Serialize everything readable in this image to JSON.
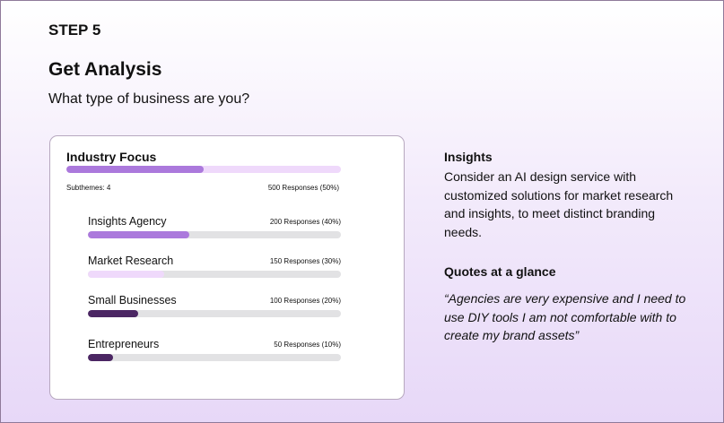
{
  "step_label": "STEP 5",
  "title": "Get Analysis",
  "question": "What type of business are you?",
  "card": {
    "title": "Industry Focus",
    "main_fraction": 0.5,
    "main_fill_color": "#ab79dc",
    "subthemes": "Subthemes: 4",
    "total": "500 Responses (50%)",
    "rows": [
      {
        "label": "Insights Agency",
        "responses": "200 Responses (40%)",
        "fraction": 0.4,
        "color": "#ab79dc"
      },
      {
        "label": "Market Research",
        "responses": "150 Responses (30%)",
        "fraction": 0.3,
        "color": "#efd9fb"
      },
      {
        "label": "Small Businesses",
        "responses": "100 Responses (20%)",
        "fraction": 0.2,
        "color": "#4b2663"
      },
      {
        "label": "Entrepreneurs",
        "responses": "50 Responses (10%)",
        "fraction": 0.1,
        "color": "#4b2663"
      }
    ]
  },
  "insights": {
    "heading": "Insights",
    "text": "Consider an AI design service with customized solutions for market research and insights,  to meet distinct branding needs."
  },
  "quotes": {
    "heading": "Quotes at a glance",
    "text": "“Agencies are very expensive and I need to use DIY tools I am not comfortable with to create my brand assets”"
  }
}
